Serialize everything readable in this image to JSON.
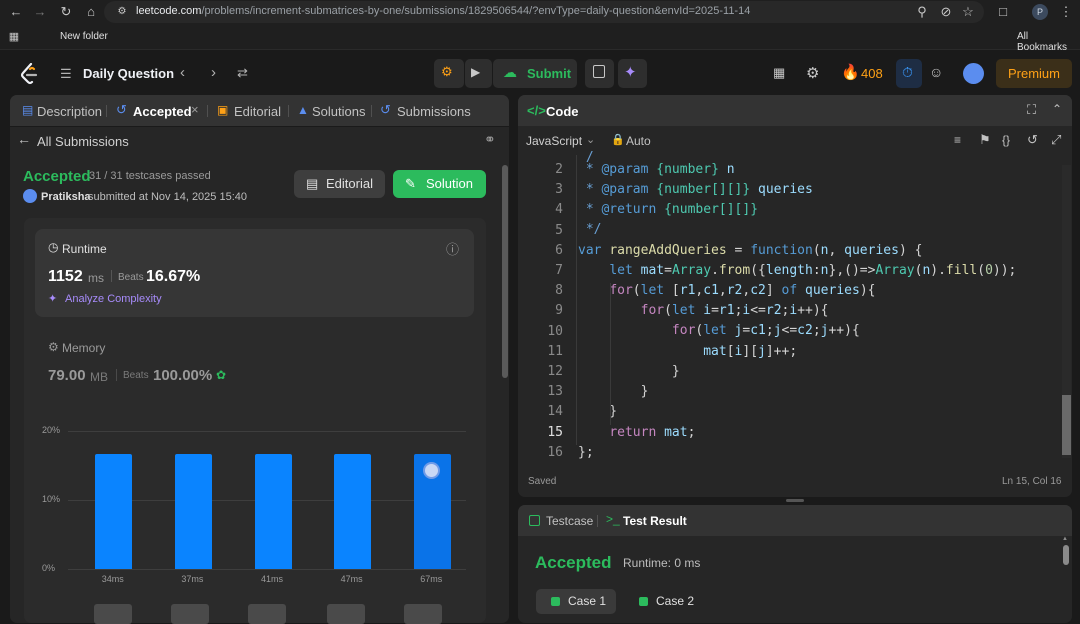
{
  "browser": {
    "url_host": "leetcode.com",
    "url_path": "/problems/increment-submatrices-by-one/submissions/1829506544/?envType=daily-question&envId=2025-11-14",
    "profile_initial": "P",
    "bookmarks": [
      "New folder"
    ],
    "all_bookmarks": "All Bookmarks"
  },
  "nav": {
    "title": "Daily Question",
    "submit_label": "Submit",
    "streak_count": "408",
    "premium_label": "Premium"
  },
  "left_tabs": {
    "description": "Description",
    "accepted": "Accepted",
    "editorial": "Editorial",
    "solutions": "Solutions",
    "submissions": "Submissions"
  },
  "submission": {
    "back_label": "All Submissions",
    "status": "Accepted",
    "testcases": "31 / 31 testcases passed",
    "user": "Pratiksha",
    "submitted_at": "submitted at Nov 14, 2025 15:40",
    "editorial_button": "Editorial",
    "solution_button": "Solution"
  },
  "runtime": {
    "label": "Runtime",
    "value": "1152",
    "unit": "ms",
    "beats_label": "Beats",
    "beats_value": "16.67%",
    "analyze_label": "Analyze Complexity"
  },
  "memory": {
    "label": "Memory",
    "value": "79.00",
    "unit": "MB",
    "beats_label": "Beats",
    "beats_value": "100.00%"
  },
  "chart_data": {
    "type": "bar",
    "categories": [
      "34ms",
      "37ms",
      "41ms",
      "47ms",
      "67ms"
    ],
    "values": [
      16.7,
      16.7,
      16.7,
      16.7,
      16.7
    ],
    "y_ticks": [
      "20%",
      "10%",
      "0%"
    ],
    "ylim": [
      0,
      20
    ],
    "highlighted_category": "67ms"
  },
  "code_panel": {
    "title": "Code",
    "language": "JavaScript",
    "mode": "Auto",
    "status": "Saved",
    "cursor": "Ln 15, Col 16",
    "line_numbers": [
      "2",
      "3",
      "4",
      "5",
      "6",
      "7",
      "8",
      "9",
      "10",
      "11",
      "12",
      "13",
      "14",
      "15",
      "16"
    ]
  },
  "result_panel": {
    "testcase_tab": "Testcase",
    "result_tab": "Test Result",
    "status": "Accepted",
    "runtime": "Runtime: 0 ms",
    "cases": [
      "Case 1",
      "Case 2"
    ]
  },
  "colors": {
    "accent_green": "#2cbb5d",
    "accent_orange": "#ffa116",
    "bar_blue": "#0a84ff"
  }
}
